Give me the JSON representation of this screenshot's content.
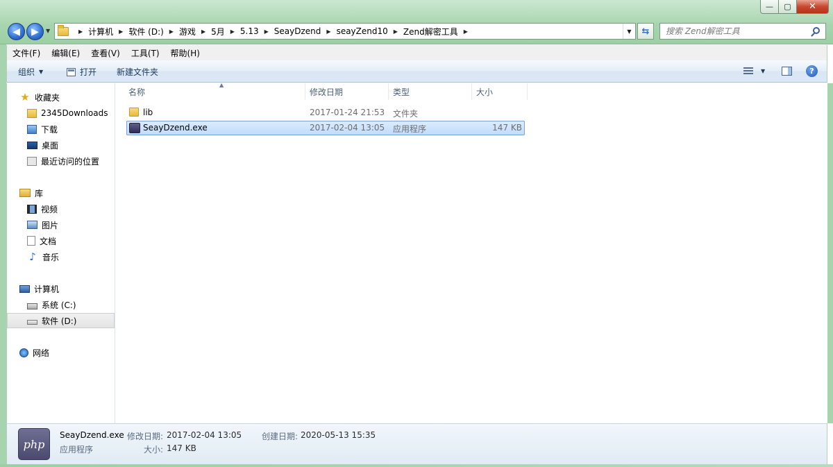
{
  "window": {
    "min_glyph": "—",
    "max_glyph": "▢",
    "close_glyph": "✕"
  },
  "address": {
    "crumbs": [
      "计算机",
      "软件 (D:)",
      "游戏",
      "5月",
      "5.13",
      "SeayDzend",
      "seayZend10",
      "Zend解密工具"
    ]
  },
  "search": {
    "placeholder": "搜索 Zend解密工具"
  },
  "menubar": {
    "items": [
      "文件(F)",
      "编辑(E)",
      "查看(V)",
      "工具(T)",
      "帮助(H)"
    ]
  },
  "toolbar": {
    "organize": "组织",
    "open": "打开",
    "new_folder": "新建文件夹"
  },
  "sidenav": {
    "favorites": {
      "label": "收藏夹",
      "items": [
        "2345Downloads",
        "下载",
        "桌面",
        "最近访问的位置"
      ]
    },
    "libraries": {
      "label": "库",
      "items": [
        "视频",
        "图片",
        "文档",
        "音乐"
      ]
    },
    "computer": {
      "label": "计算机",
      "items": [
        "系统 (C:)",
        "软件 (D:)"
      ],
      "selected": "软件 (D:)"
    },
    "network": {
      "label": "网络"
    }
  },
  "filelist": {
    "columns": [
      "名称",
      "修改日期",
      "类型",
      "大小"
    ],
    "rows": [
      {
        "name": "lib",
        "modified": "2017-01-24 21:53",
        "type": "文件夹",
        "size": ""
      },
      {
        "name": "SeayDzend.exe",
        "modified": "2017-02-04 13:05",
        "type": "应用程序",
        "size": "147 KB"
      }
    ],
    "selected_row": 1
  },
  "details": {
    "thumb_text": "php",
    "name": "SeayDzend.exe",
    "type": "应用程序",
    "modified_label": "修改日期:",
    "modified_value": "2017-02-04 13:05",
    "created_label": "创建日期:",
    "created_value": "2020-05-13 15:35",
    "size_label": "大小:",
    "size_value": "147 KB"
  },
  "colors": {
    "accent": "#2f6fd1",
    "frame": "#a6d4ae",
    "selection": "#c1dcfc"
  }
}
